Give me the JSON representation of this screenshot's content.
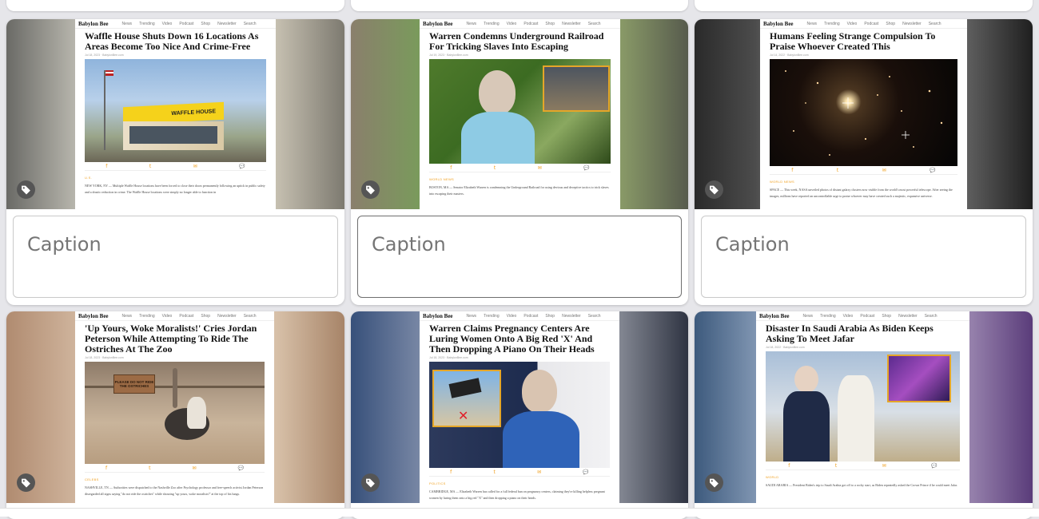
{
  "nav": {
    "brand": "Babylon Bee",
    "items": [
      "News",
      "Trending",
      "Video",
      "Podcast",
      "Shop",
      "Newsletter",
      "Search"
    ]
  },
  "caption_placeholder": "Caption",
  "colors": {
    "accent": "#f0a020",
    "tag_bg": "#555555"
  },
  "icons": [
    "tag-icon",
    "facebook-icon",
    "twitter-icon",
    "email-icon",
    "comment-icon"
  ],
  "share_icons": [
    "f",
    "t",
    "✉",
    "💬"
  ],
  "cards": [
    {
      "headline": "Waffle House Shuts Down 16 Locations As Areas Become Too Nice And Crime-Free",
      "byline": "Jul 18, 2023 · BabylonBee.com",
      "category": "U.S.",
      "body": "NEW YORK, NY — Multiple Waffle House locations have been forced to close their doors permanently following an uptick in public safety and a drastic reduction in crime. The Waffle House locations were simply no longer able to function in",
      "sign_text": "WAFFLE HOUSE"
    },
    {
      "headline": "Warren Condemns Underground Railroad For Tricking Slaves Into Escaping",
      "byline": "Jul 19, 2023 · BabylonBee.com",
      "category": "WORLD NEWS",
      "body": "BOSTON, MA — Senator Elizabeth Warren is condemning the Underground Railroad for using devious and deceptive tactics to trick slaves into escaping their masters."
    },
    {
      "headline": "Humans Feeling Strange Compulsion To Praise Whoever Created This",
      "byline": "Jul 14, 2022 · BabylonBee.com",
      "category": "WORLD NEWS",
      "body": "SPACE — This week, NASA unveiled photos of distant galaxy clusters now visible from the world's most powerful telescope. After seeing the images, millions have reported an uncontrollable urge to praise whoever may have created such a majestic, expansive universe."
    },
    {
      "headline": "'Up Yours, Woke Moralists!' Cries Jordan Peterson While Attempting To Ride The Ostriches At The Zoo",
      "byline": "Jul 18, 2023 · BabylonBee.com",
      "category": "CELEBS",
      "body": "NASHVILLE, TN — Authorities were dispatched to the Nashville Zoo after Psychology professor and free-speech activist Jordan Peterson disregarded all signs saying \"do not ride the ostriches\" while shouting \"up yours, woke moralists!\" at the top of his lungs.",
      "sign_text": "PLEASE DO NOT RIDE THE OSTRICHES"
    },
    {
      "headline": "Warren Claims Pregnancy Centers Are Luring Women Onto A Big Red 'X' And Then Dropping A Piano On Their Heads",
      "byline": "Jul 18, 2023 · BabylonBee.com",
      "category": "POLITICS",
      "body": "CAMBRIDGE, MA — Elizabeth Warren has called for a full federal ban on pregnancy centers, claiming they're killing helpless pregnant women by luring them onto a big red \"X\" and then dropping a piano on their heads."
    },
    {
      "headline": "Disaster In Saudi Arabia As Biden Keeps Asking To Meet Jafar",
      "byline": "Jul 18, 2022 · BabylonBee.com",
      "category": "WORLD",
      "body": "SAUDI ARABIA — President Biden's trip to Saudi Arabia got off to a rocky start, as Biden repeatedly asked the Crown Prince if he could meet Jafar."
    }
  ]
}
